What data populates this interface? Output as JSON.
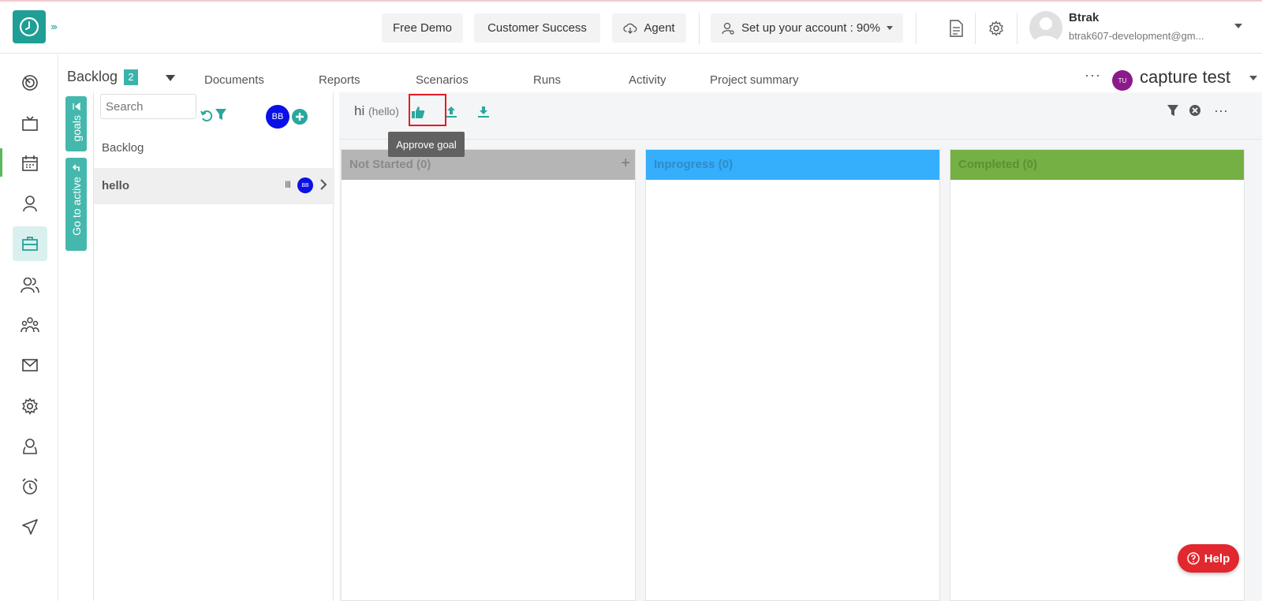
{
  "topbar": {
    "free_demo": "Free Demo",
    "customer_success": "Customer Success",
    "agent": "Agent",
    "setup": "Set up your account : 90%",
    "user_name": "Btrak",
    "user_email": "btrak607-development@gm..."
  },
  "tabs": {
    "backlog": "Backlog",
    "backlog_count": "2",
    "items": [
      "Documents",
      "Reports",
      "Scenarios",
      "Runs",
      "Activity",
      "Project summary"
    ],
    "project_more": "···",
    "project_initials": "TU",
    "project_name": "capture test"
  },
  "side_tabs": {
    "goals": "goals",
    "go_to_active": "Go to active"
  },
  "goals_panel": {
    "search_placeholder": "Search",
    "assignee_initials": "BB",
    "list_header": "Backlog",
    "goal": {
      "name": "hello",
      "owner_initials": "BB",
      "bars": "III"
    }
  },
  "main": {
    "goal_title": "hi",
    "goal_subtitle": "(hello)",
    "tooltip": "Approve goal",
    "more": "···",
    "columns": [
      {
        "label": "Not Started (0)",
        "color": "#b5b5b5",
        "text_color": "#8a8a8a"
      },
      {
        "label": "Inprogress (0)",
        "color": "#35aefc",
        "text_color": "#2d8bc9"
      },
      {
        "label": "Completed (0)",
        "color": "#74b043",
        "text_color": "#5b9133"
      }
    ]
  },
  "help": "Help",
  "colors": {
    "accent": "#1f9e95",
    "teal_tab": "#45b8ad",
    "highlight": "#e31b23"
  }
}
